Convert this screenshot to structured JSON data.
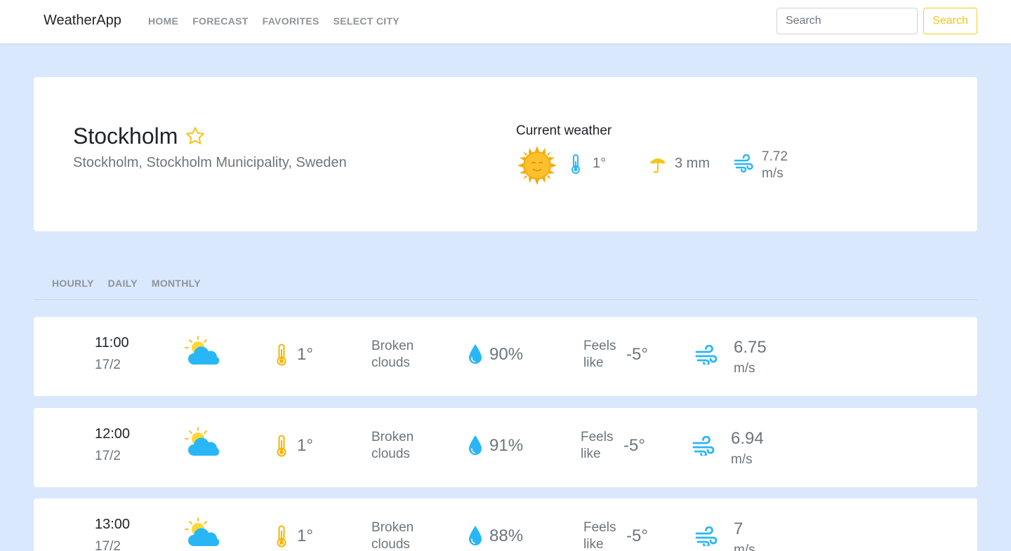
{
  "navbar": {
    "brand": "WeatherApp",
    "links": [
      "HOME",
      "FORECAST",
      "FAVORITES",
      "SELECT CITY"
    ],
    "search_placeholder": "Search",
    "search_button": "Search"
  },
  "location": {
    "city": "Stockholm",
    "full_name": "Stockholm, Stockholm Municipality, Sweden",
    "favorite_icon": "star-outline-icon",
    "current": {
      "title": "Current weather",
      "icon": "sun-icon",
      "temp": "1°",
      "rain": "3 mm",
      "wind": "7.72",
      "wind_unit": "m/s"
    }
  },
  "tabs": [
    "HOURLY",
    "DAILY",
    "MONTHLY"
  ],
  "hourly": [
    {
      "time": "11:00",
      "date": "17/2",
      "icon": "partly-cloudy-icon",
      "temp": "1°",
      "desc_line1": "Broken",
      "desc_line2": "clouds",
      "humidity": "90%",
      "feels_label1": "Feels",
      "feels_label2": "like",
      "feels": "-5°",
      "wind": "6.75",
      "wind_unit": "m/s"
    },
    {
      "time": "12:00",
      "date": "17/2",
      "icon": "partly-cloudy-icon",
      "temp": "1°",
      "desc_line1": "Broken",
      "desc_line2": "clouds",
      "humidity": "91%",
      "feels_label1": "Feels",
      "feels_label2": "like",
      "feels": "-5°",
      "wind": "6.94",
      "wind_unit": "m/s"
    },
    {
      "time": "13:00",
      "date": "17/2",
      "icon": "partly-cloudy-icon",
      "temp": "1°",
      "desc_line1": "Broken",
      "desc_line2": "clouds",
      "humidity": "88%",
      "feels_label1": "Feels",
      "feels_label2": "like",
      "feels": "-5°",
      "wind": "7",
      "wind_unit": "m/s"
    }
  ],
  "colors": {
    "background": "#d9e8fd",
    "accent_yellow": "#f5c518",
    "icon_blue": "#29b6f6",
    "muted_text": "#6c757d"
  }
}
